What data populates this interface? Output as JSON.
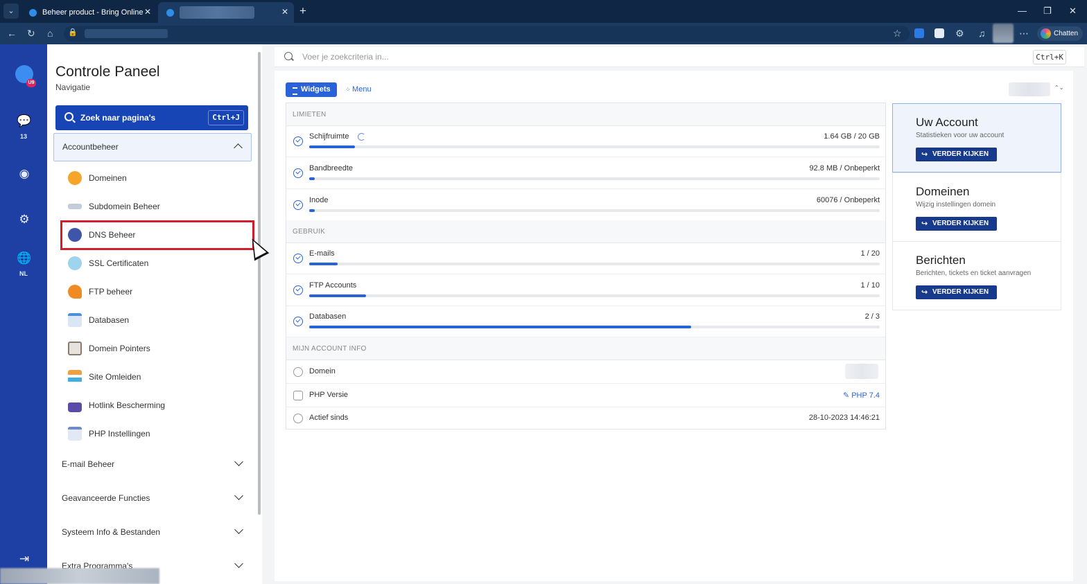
{
  "browser": {
    "tabs": [
      {
        "title": "Beheer product - Bring Online"
      },
      {
        "title": ""
      }
    ],
    "chatten_label": "Chatten"
  },
  "rail": {
    "chat_count": "13",
    "language": "NL",
    "logo_badge": "U9"
  },
  "nav": {
    "title": "Controle Paneel",
    "subtitle": "Navigatie",
    "search_label": "Zoek naar pagina's",
    "search_shortcut": "Ctrl+J",
    "open_section": "Accountbeheer",
    "items": [
      {
        "label": "Domeinen",
        "color": "#f4a52a"
      },
      {
        "label": "Subdomein Beheer",
        "color": "#7a8aa0"
      },
      {
        "label": "DNS Beheer",
        "color": "#3f55a8"
      },
      {
        "label": "SSL Certificaten",
        "color": "#35a7d8"
      },
      {
        "label": "FTP beheer",
        "color": "#f08a24"
      },
      {
        "label": "Databasen",
        "color": "#4a90d9"
      },
      {
        "label": "Domein Pointers",
        "color": "#8c7a6a"
      },
      {
        "label": "Site Omleiden",
        "color": "#f0a040"
      },
      {
        "label": "Hotlink Bescherming",
        "color": "#5b4aa8"
      },
      {
        "label": "PHP Instellingen",
        "color": "#6b8cc8"
      }
    ],
    "sections": [
      {
        "label": "E-mail Beheer"
      },
      {
        "label": "Geavanceerde Functies"
      },
      {
        "label": "Systeem Info & Bestanden"
      },
      {
        "label": "Extra Programma's"
      }
    ]
  },
  "main": {
    "search_placeholder": "Voer je zoekcriteria in...",
    "search_shortcut": "Ctrl+K",
    "tab_widgets": "Widgets",
    "tab_menu": "Menu",
    "limits_header": "LIMIETEN",
    "limits": [
      {
        "label": "Schijfruimte",
        "value": "1.64 GB / 20 GB",
        "progress": 0.08
      },
      {
        "label": "Bandbreedte",
        "value": "92.8 MB / Onbeperkt",
        "progress": 0.01
      },
      {
        "label": "Inode",
        "value": "60076 / Onbeperkt",
        "progress": 0.01
      }
    ],
    "usage_header": "GEBRUIK",
    "usage": [
      {
        "label": "E-mails",
        "value": "1 / 20",
        "progress": 0.05
      },
      {
        "label": "FTP Accounts",
        "value": "1 / 10",
        "progress": 0.1
      },
      {
        "label": "Databasen",
        "value": "2 / 3",
        "progress": 0.67
      }
    ],
    "info_header": "MIJN ACCOUNT INFO",
    "info": {
      "domain_label": "Domein",
      "php_label": "PHP Versie",
      "php_value": "PHP 7.4",
      "since_label": "Actief sinds",
      "since_value": "28-10-2023 14:46:21"
    },
    "cards": [
      {
        "title": "Uw Account",
        "subtitle": "Statistieken voor uw account",
        "button": "VERDER KIJKEN"
      },
      {
        "title": "Domeinen",
        "subtitle": "Wijzig instellingen domein",
        "button": "VERDER KIJKEN"
      },
      {
        "title": "Berichten",
        "subtitle": "Berichten, tickets en ticket aanvragen",
        "button": "VERDER KIJKEN"
      }
    ]
  }
}
